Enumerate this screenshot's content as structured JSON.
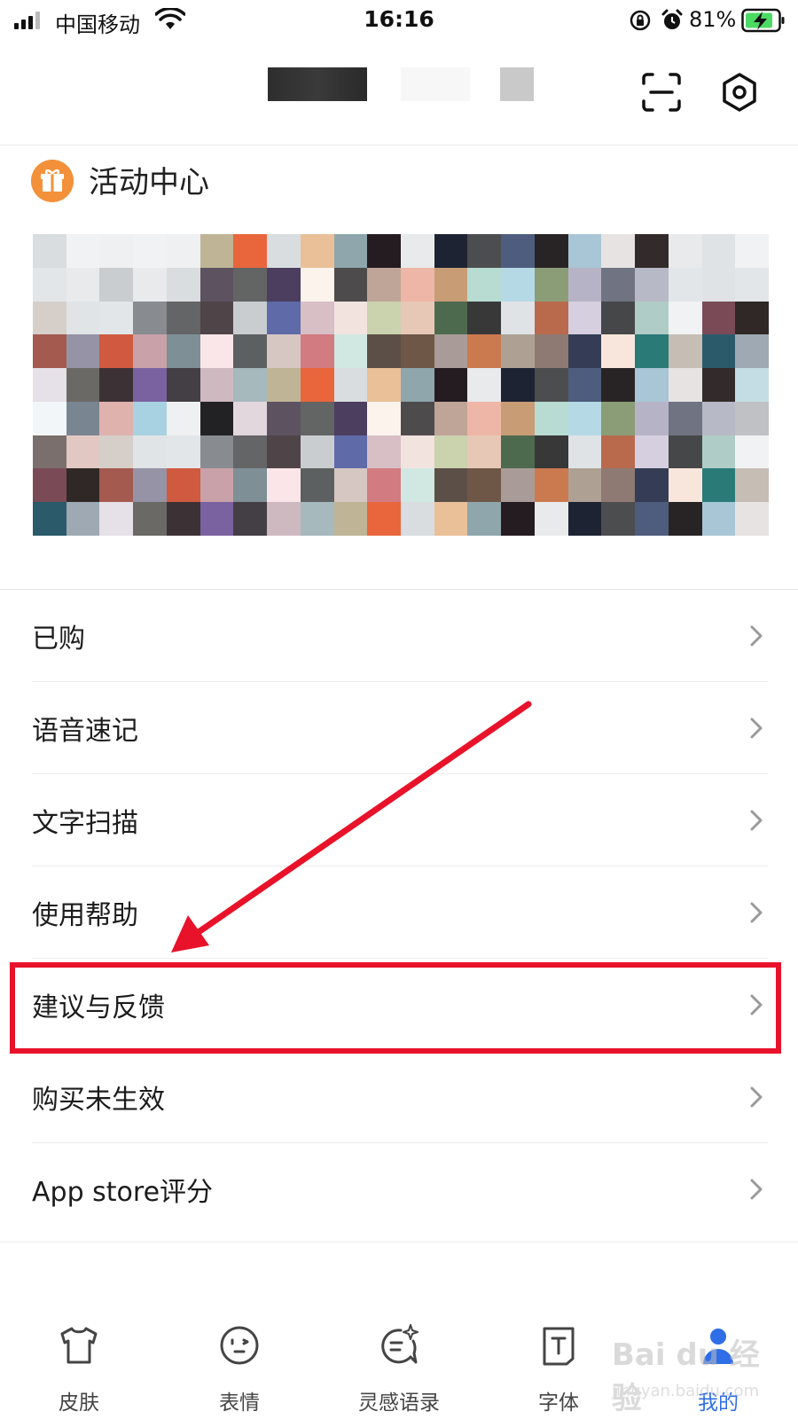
{
  "status_bar": {
    "carrier": "中国移动",
    "time": "16:16",
    "battery": "81%"
  },
  "header": {
    "icons": [
      "scan-icon",
      "settings-hexagon-icon"
    ]
  },
  "activity": {
    "title": "活动中心",
    "icon": "gift-icon"
  },
  "menu": {
    "items": [
      {
        "label": "已购"
      },
      {
        "label": "语音速记"
      },
      {
        "label": "文字扫描"
      },
      {
        "label": "使用帮助"
      },
      {
        "label": "建议与反馈"
      },
      {
        "label": "购买未生效"
      },
      {
        "label": "App store评分"
      }
    ]
  },
  "annotation": {
    "color": "#e8132a",
    "highlighted_item": "建议与反馈"
  },
  "tabs": {
    "items": [
      {
        "label": "皮肤",
        "icon": "tshirt-icon"
      },
      {
        "label": "表情",
        "icon": "emoji-face-icon"
      },
      {
        "label": "灵感语录",
        "icon": "sparkle-chat-icon"
      },
      {
        "label": "字体",
        "icon": "font-t-icon"
      },
      {
        "label": "我的",
        "icon": "person-icon",
        "active": true
      }
    ],
    "active_color": "#2f6ee6"
  },
  "watermark": {
    "text": "Bai du 经验",
    "sub": "jingyan.baidu.com"
  }
}
